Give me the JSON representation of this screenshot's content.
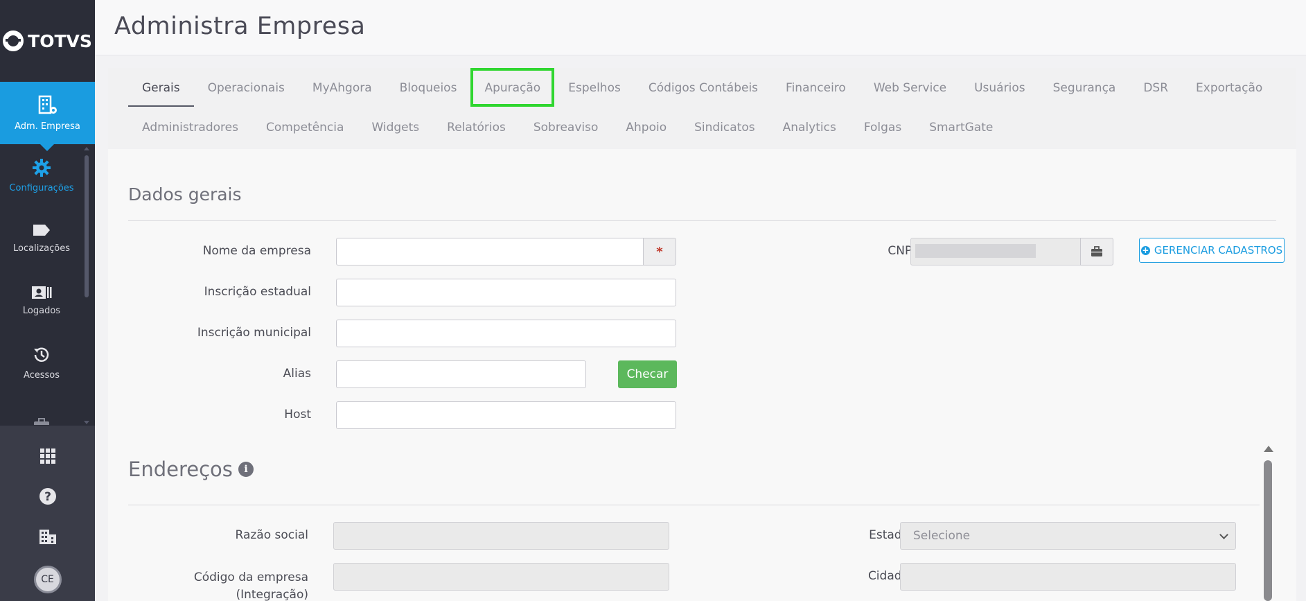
{
  "brand": {
    "logo_text": "TOTVS"
  },
  "sidebar": {
    "active_item": {
      "label": "Adm. Empresa"
    },
    "items": [
      {
        "label": "Configurações"
      },
      {
        "label": "Localizações"
      },
      {
        "label": "Logados"
      },
      {
        "label": "Acessos"
      }
    ],
    "avatar_initials": "CE"
  },
  "header": {
    "title": "Administra Empresa"
  },
  "tabs": {
    "row1": [
      "Gerais",
      "Operacionais",
      "MyAhgora",
      "Bloqueios",
      "Apuração",
      "Espelhos",
      "Códigos Contábeis",
      "Financeiro",
      "Web Service",
      "Usuários",
      "Segurança",
      "DSR",
      "Exportação"
    ],
    "row2": [
      "Administradores",
      "Competência",
      "Widgets",
      "Relatórios",
      "Sobreaviso",
      "Ahpoio",
      "Sindicatos",
      "Analytics",
      "Folgas",
      "SmartGate"
    ],
    "active": "Gerais",
    "highlighted": "Apuração"
  },
  "dados_gerais": {
    "title": "Dados gerais",
    "nome_label": "Nome da empresa",
    "nome_value": "",
    "required_mark": "*",
    "inscricao_estadual_label": "Inscrição estadual",
    "inscricao_estadual_value": "",
    "inscricao_municipal_label": "Inscrição municipal",
    "inscricao_municipal_value": "",
    "alias_label": "Alias",
    "alias_value": "",
    "checar_label": "Checar",
    "host_label": "Host",
    "host_value": "",
    "cnpj_label": "CNPJ:",
    "gerenciar_label": "GERENCIAR CADASTROS"
  },
  "enderecos": {
    "title": "Endereços",
    "razao_social_label": "Razão social",
    "codigo_label_1": "Código da empresa",
    "codigo_label_2": "(Integração)",
    "estado_label": "Estado",
    "estado_value": "Selecione",
    "cidade_label": "Cidade"
  },
  "colors": {
    "sidebar_bg": "#2b2d38",
    "accent": "#1a9ce0",
    "success": "#5cb85c",
    "highlight": "#30d630"
  }
}
